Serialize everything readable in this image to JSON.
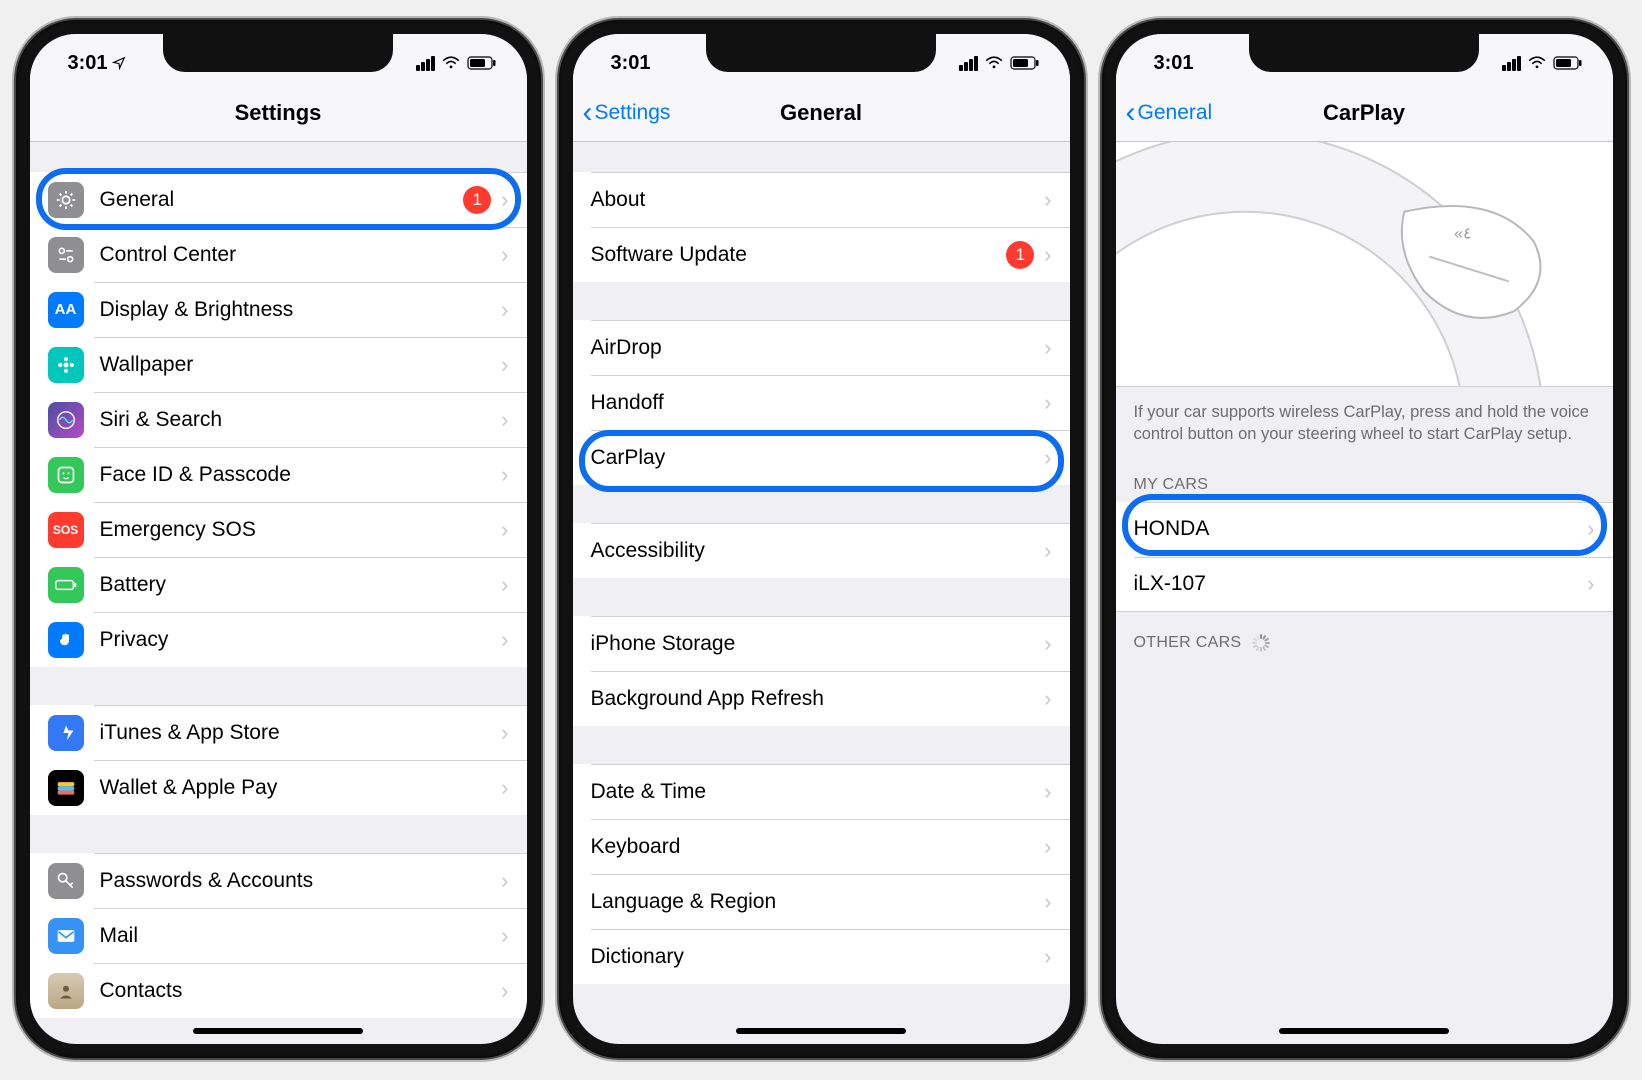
{
  "status": {
    "time": "3:01"
  },
  "phone1": {
    "nav_title": "Settings",
    "items": [
      {
        "label": "General",
        "badge_text": "1",
        "highlight": true
      },
      {
        "label": "Control Center"
      },
      {
        "label": "Display & Brightness"
      },
      {
        "label": "Wallpaper"
      },
      {
        "label": "Siri & Search"
      },
      {
        "label": "Face ID & Passcode"
      },
      {
        "label": "Emergency SOS"
      },
      {
        "label": "Battery"
      },
      {
        "label": "Privacy"
      }
    ],
    "group2": [
      {
        "label": "iTunes & App Store"
      },
      {
        "label": "Wallet & Apple Pay"
      }
    ],
    "group3": [
      {
        "label": "Passwords & Accounts"
      },
      {
        "label": "Mail"
      },
      {
        "label": "Contacts"
      }
    ]
  },
  "phone2": {
    "back_label": "Settings",
    "nav_title": "General",
    "g1": [
      {
        "label": "About"
      },
      {
        "label": "Software Update",
        "badge_text": "1"
      }
    ],
    "g2": [
      {
        "label": "AirDrop"
      },
      {
        "label": "Handoff"
      },
      {
        "label": "CarPlay",
        "highlight": true
      }
    ],
    "g3": [
      {
        "label": "Accessibility"
      }
    ],
    "g4": [
      {
        "label": "iPhone Storage"
      },
      {
        "label": "Background App Refresh"
      }
    ],
    "g5": [
      {
        "label": "Date & Time"
      },
      {
        "label": "Keyboard"
      },
      {
        "label": "Language & Region"
      },
      {
        "label": "Dictionary"
      }
    ]
  },
  "phone3": {
    "back_label": "General",
    "nav_title": "CarPlay",
    "help_text": "If your car supports wireless CarPlay, press and hold the voice control button on your steering wheel to start CarPlay setup.",
    "section_mycars": "MY CARS",
    "cars": [
      {
        "label": "HONDA",
        "highlight": true
      },
      {
        "label": "iLX-107"
      }
    ],
    "section_other": "OTHER CARS"
  }
}
